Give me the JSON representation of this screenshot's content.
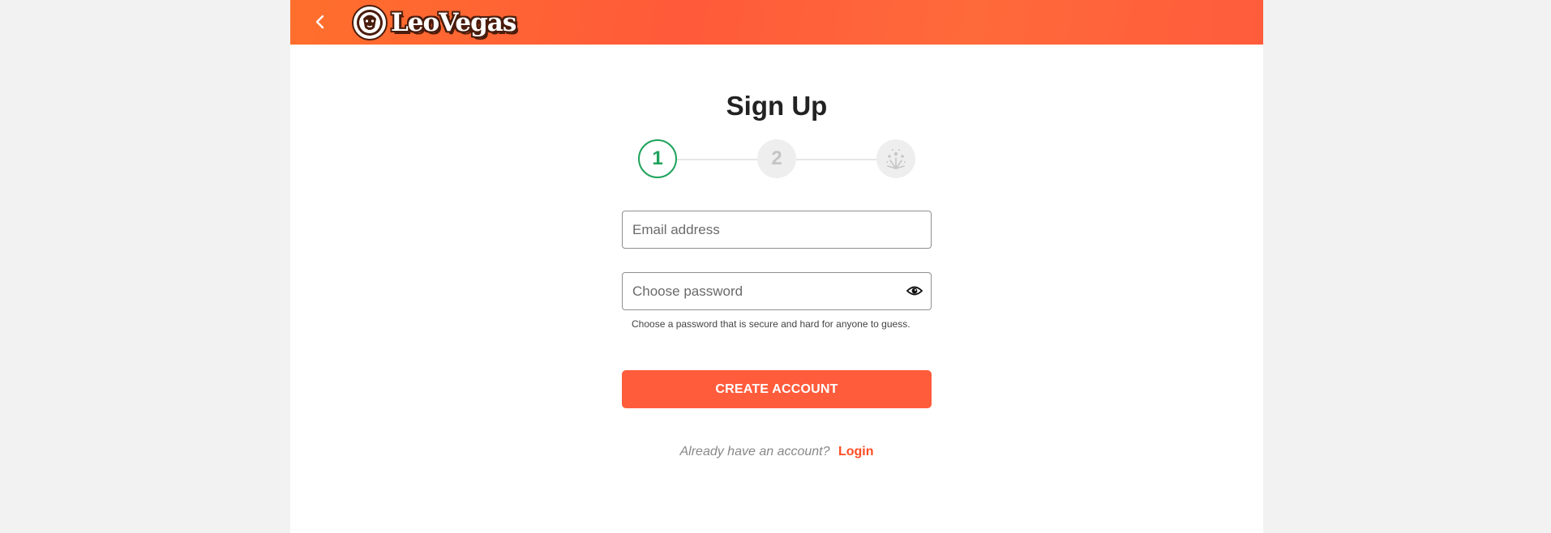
{
  "header": {
    "brand": "LeoVegas",
    "back_icon": "chevron-left-icon",
    "gradient_colors": [
      "#ff6f2c",
      "#ff5a3a"
    ]
  },
  "signup": {
    "title": "Sign Up",
    "steps": [
      {
        "label": "1",
        "state": "active"
      },
      {
        "label": "2",
        "state": "inactive"
      },
      {
        "label": "",
        "icon": "fireworks-icon",
        "state": "inactive"
      }
    ],
    "email": {
      "placeholder": "Email address",
      "value": ""
    },
    "password": {
      "placeholder": "Choose password",
      "value": "",
      "toggle_icon": "eye-icon"
    },
    "password_hint": "Choose a password that is secure and hard for anyone to guess.",
    "create_button": "CREATE ACCOUNT",
    "already_text": "Already have an account?",
    "login_link": "Login"
  },
  "colors": {
    "accent": "#ff5c3c",
    "step_active": "#1fa35c",
    "background": "#f2f2f2"
  }
}
